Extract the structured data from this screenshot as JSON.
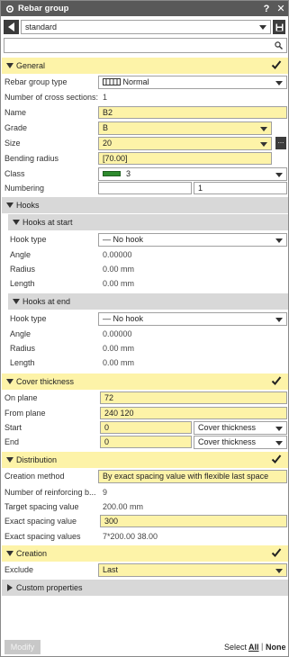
{
  "window": {
    "title": "Rebar group"
  },
  "preset": {
    "value": "standard"
  },
  "search": {
    "placeholder": ""
  },
  "sections": {
    "general": "General",
    "hooks": "Hooks",
    "hooks_start": "Hooks at start",
    "hooks_end": "Hooks at end",
    "cover": "Cover thickness",
    "distribution": "Distribution",
    "creation": "Creation",
    "custom": "Custom properties"
  },
  "general": {
    "rebar_group_type_label": "Rebar group type",
    "rebar_group_type_value": "Normal",
    "num_cross_sections_label": "Number of cross sections:",
    "num_cross_sections_value": "1",
    "name_label": "Name",
    "name_value": "B2",
    "grade_label": "Grade",
    "grade_value": "B",
    "size_label": "Size",
    "size_value": "20",
    "bending_radius_label": "Bending radius",
    "bending_radius_value": "[70.00]",
    "class_label": "Class",
    "class_value": "3",
    "class_color": "#2e8b2e",
    "numbering_label": "Numbering",
    "numbering_prefix": "",
    "numbering_start": "1"
  },
  "hooks_start": {
    "hook_type_label": "Hook type",
    "hook_type_value": "— No hook",
    "angle_label": "Angle",
    "angle_value": "0.00000",
    "radius_label": "Radius",
    "radius_value": "0.00 mm",
    "length_label": "Length",
    "length_value": "0.00 mm"
  },
  "hooks_end": {
    "hook_type_label": "Hook type",
    "hook_type_value": "— No hook",
    "angle_label": "Angle",
    "angle_value": "0.00000",
    "radius_label": "Radius",
    "radius_value": "0.00 mm",
    "length_label": "Length",
    "length_value": "0.00 mm"
  },
  "cover": {
    "on_plane_label": "On plane",
    "on_plane_value": "72",
    "from_plane_label": "From plane",
    "from_plane_value": "240 120",
    "start_label": "Start",
    "start_value": "0",
    "start_mode": "Cover thickness",
    "end_label": "End",
    "end_value": "0",
    "end_mode": "Cover thickness"
  },
  "distribution": {
    "creation_method_label": "Creation method",
    "creation_method_value": "By exact spacing value with flexible last space",
    "num_bars_label": "Number of reinforcing b...",
    "num_bars_value": "9",
    "target_spacing_label": "Target spacing value",
    "target_spacing_value": "200.00 mm",
    "exact_spacing_label": "Exact spacing value",
    "exact_spacing_value": "300",
    "exact_spacing_values_label": "Exact spacing values",
    "exact_spacing_values_value": "7*200.00 38.00"
  },
  "creation": {
    "exclude_label": "Exclude",
    "exclude_value": "Last"
  },
  "footer": {
    "modify": "Modify",
    "select": "Select",
    "all": "All",
    "separator": "|",
    "none": "None"
  }
}
